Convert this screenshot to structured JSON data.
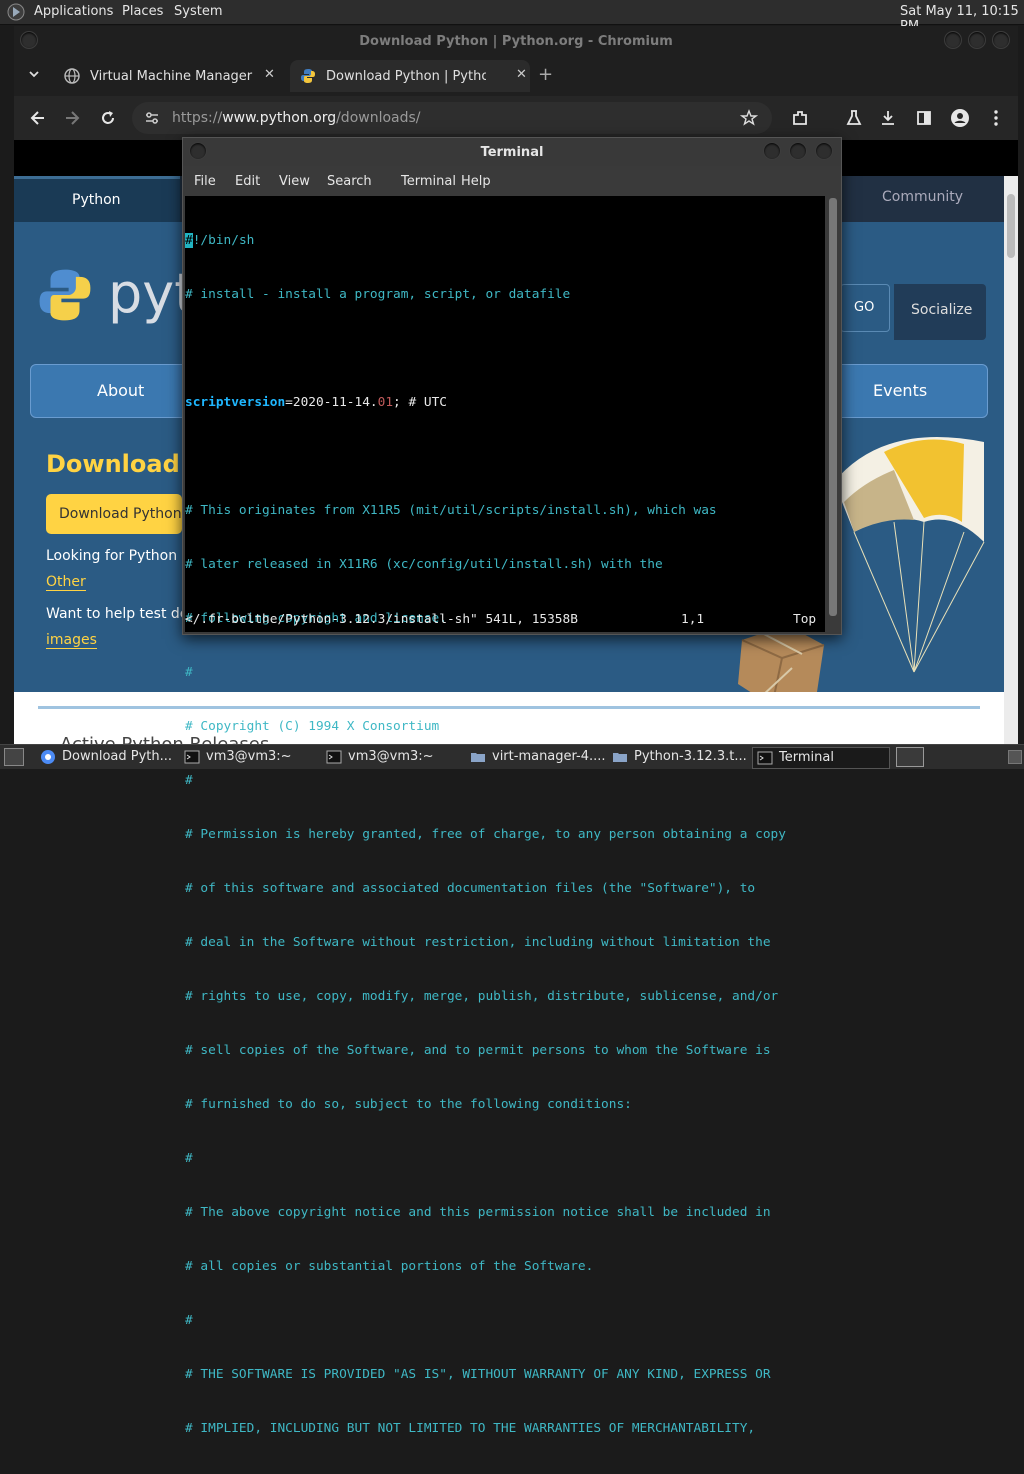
{
  "panel": {
    "menus": [
      "Applications",
      "Places",
      "System"
    ],
    "clock": "Sat May 11, 10:15 PM"
  },
  "browser": {
    "window_title": "Download Python | Python.org - Chromium",
    "tabs": [
      {
        "label": "Virtual Machine Manager",
        "close": "✕"
      },
      {
        "label": "Download Python | Python.or",
        "close": "✕"
      }
    ],
    "new_tab": "+",
    "url_prefix": "https://",
    "url_host": "www.python.org",
    "url_path": "/downloads/"
  },
  "python_page": {
    "nav_python": "Python",
    "nav_community": "Community",
    "logo_text": "pyt",
    "go": "GO",
    "socialize": "Socialize",
    "about": "About",
    "events": "Events",
    "download_heading": "Download t",
    "download_button": "Download Python",
    "looking_for": "Looking for Python v",
    "other": "Other",
    "want_help": "Want to help test dev",
    "images": "images",
    "active_releases": "Active Python Releases"
  },
  "terminal": {
    "title": "Terminal",
    "menu": [
      "File",
      "Edit",
      "View",
      "Search",
      "Terminal",
      "Help"
    ],
    "lines": {
      "l1_cursor": "#",
      "l1_rest": "!/bin/sh",
      "l2": "# install - install a program, script, or datafile",
      "l4_kw": "scriptversion",
      "l4_mid": "=2020-11-14.",
      "l4_num": "01",
      "l4_end": "; # UTC",
      "l6": "# This originates from X11R5 (mit/util/scripts/install.sh), which was",
      "l7": "# later released in X11R6 (xc/config/util/install.sh) with the",
      "l8": "# following copyright and license.",
      "l9": "#",
      "l10": "# Copyright (C) 1994 X Consortium",
      "l11": "#",
      "l12": "# Permission is hereby granted, free of charge, to any person obtaining a copy",
      "l13": "# of this software and associated documentation files (the \"Software\"), to",
      "l14": "# deal in the Software without restriction, including without limitation the",
      "l15": "# rights to use, copy, modify, merge, publish, distribute, sublicense, and/or",
      "l16": "# sell copies of the Software, and to permit persons to whom the Software is",
      "l17": "# furnished to do so, subject to the following conditions:",
      "l18": "#",
      "l19": "# The above copyright notice and this permission notice shall be included in",
      "l20": "# all copies or substantial portions of the Software.",
      "l21": "#",
      "l22": "# THE SOFTWARE IS PROVIDED \"AS IS\", WITHOUT WARRANTY OF ANY KIND, EXPRESS OR",
      "l23": "# IMPLIED, INCLUDING BUT NOT LIMITED TO THE WARRANTIES OF MERCHANTABILITY,"
    },
    "status_file": "</.fr-bclthe/Python-3.12.3/install-sh\" 541L, 15358B",
    "status_pos": "1,1",
    "status_top": "Top"
  },
  "taskbar": {
    "items": [
      "Download Pyth...",
      "vm3@vm3:~",
      "vm3@vm3:~",
      "virt-manager-4....",
      "Python-3.12.3.t...",
      "Terminal"
    ]
  }
}
